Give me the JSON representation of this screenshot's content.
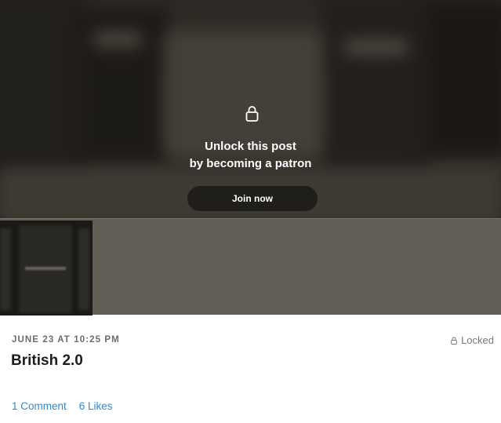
{
  "locked_overlay": {
    "line1": "Unlock this post",
    "line2": "by becoming a patron",
    "join_label": "Join now"
  },
  "post": {
    "date": "JUNE 23 AT 10:25 PM",
    "title": "British 2.0",
    "status": "Locked",
    "comments": "1 Comment",
    "likes": "6 Likes"
  },
  "icons": {
    "overlay_lock": "lock-icon",
    "status_lock": "lock-icon"
  },
  "colors": {
    "link": "#2e8bd1",
    "title": "#1e1d1b",
    "meta": "#6f6c66"
  }
}
